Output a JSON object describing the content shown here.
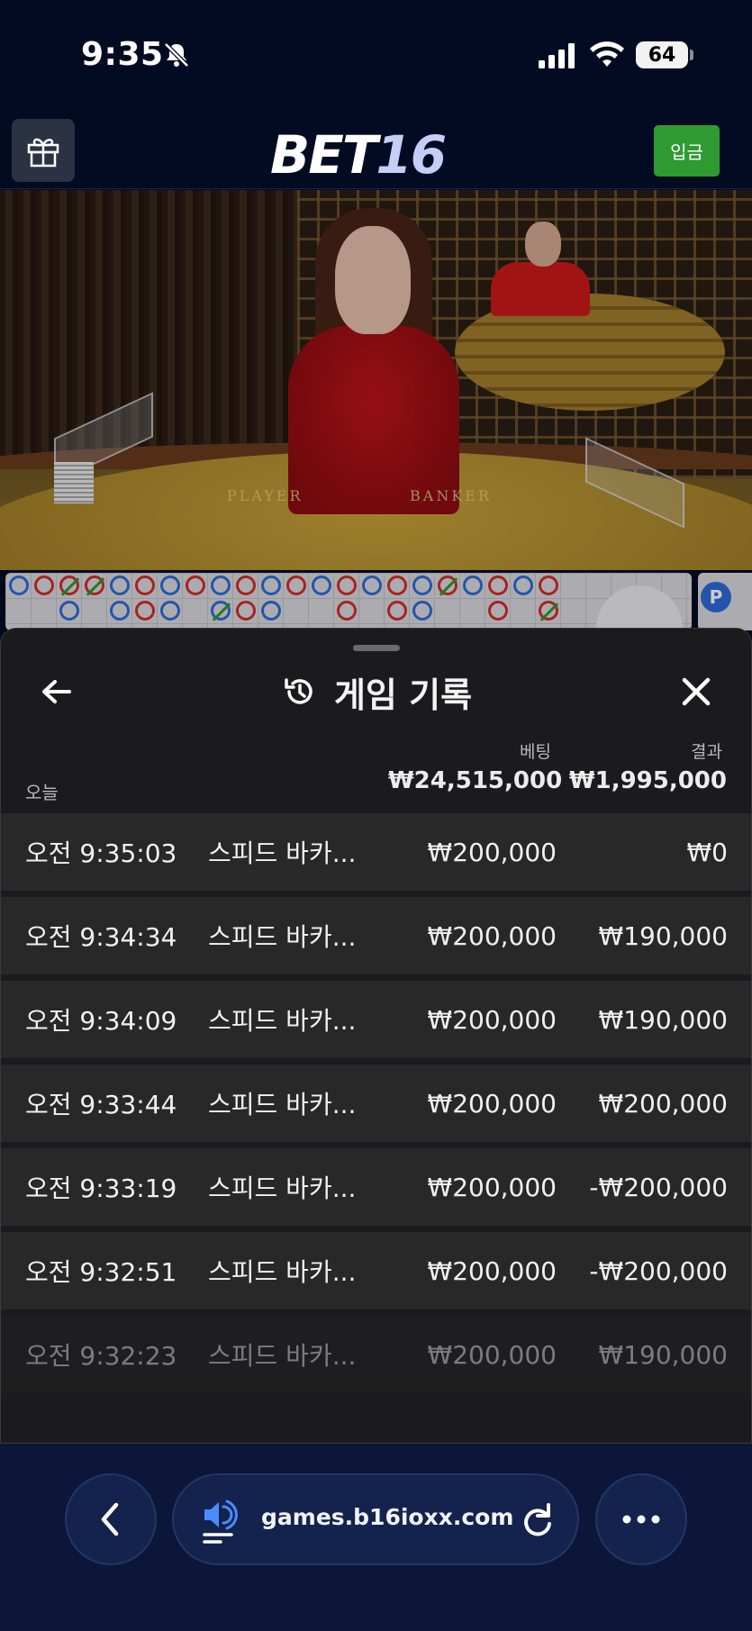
{
  "status_bar": {
    "time": "9:35",
    "battery": "64"
  },
  "header": {
    "logo_main": "BET",
    "logo_number": "16",
    "deposit_label": "입금"
  },
  "video": {
    "player_label": "PLAYER",
    "banker_label": "BANKER"
  },
  "roadmap": {
    "side_letter": "P"
  },
  "history": {
    "title": "게임 기록",
    "bet_header": "베팅",
    "result_header": "결과",
    "today_label": "오늘",
    "total_bet": "₩24,515,000",
    "total_result": "₩1,995,000",
    "rows": [
      {
        "time": "오전 9:35:03",
        "game": "스피드 바카...",
        "bet": "₩200,000",
        "result": "₩0"
      },
      {
        "time": "오전 9:34:34",
        "game": "스피드 바카...",
        "bet": "₩200,000",
        "result": "₩190,000"
      },
      {
        "time": "오전 9:34:09",
        "game": "스피드 바카...",
        "bet": "₩200,000",
        "result": "₩190,000"
      },
      {
        "time": "오전 9:33:44",
        "game": "스피드 바카...",
        "bet": "₩200,000",
        "result": "₩200,000"
      },
      {
        "time": "오전 9:33:19",
        "game": "스피드 바카...",
        "bet": "₩200,000",
        "result": "-₩200,000"
      },
      {
        "time": "오전 9:32:51",
        "game": "스피드 바카...",
        "bet": "₩200,000",
        "result": "-₩200,000"
      },
      {
        "time": "오전 9:32:23",
        "game": "스피드 바카...",
        "bet": "₩200,000",
        "result": "₩190,000"
      }
    ]
  },
  "browser": {
    "url": "games.b16ioxx.com"
  },
  "colors": {
    "background": "#020b22",
    "deposit": "#2f9a32",
    "sheet": "#1b1b1d",
    "row": "#282829",
    "browser_bar": "#0b1638"
  }
}
